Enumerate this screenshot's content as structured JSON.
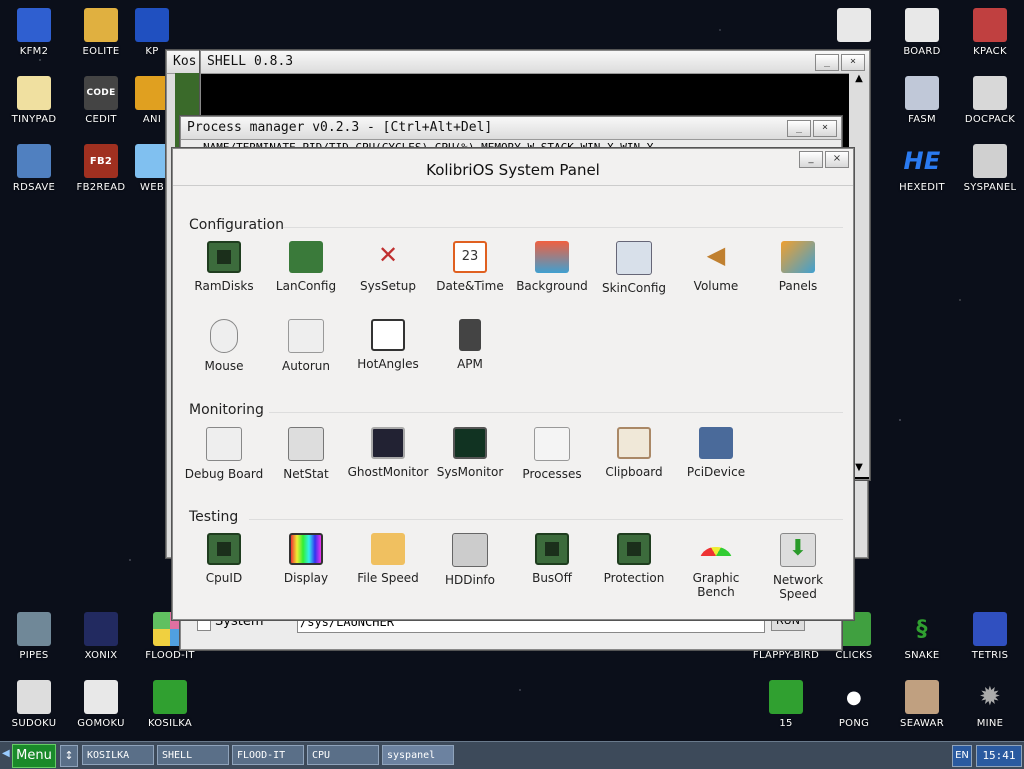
{
  "desktop": {
    "left_icons": [
      {
        "label": "KFM2",
        "icon": "floppy-icon",
        "color": "#2f5fd0"
      },
      {
        "label": "EOLITE",
        "icon": "folder-icon",
        "color": "#e0b040"
      },
      {
        "label": "KP",
        "icon": "kpack-icon",
        "color": "#2050c0"
      },
      {
        "label": "TINYPAD",
        "icon": "notepad-icon",
        "color": "#f0e0a0"
      },
      {
        "label": "CEDIT",
        "icon": "code-editor-icon",
        "color": "#444444"
      },
      {
        "label": "ANI",
        "icon": "animation-icon",
        "color": "#e0a020"
      },
      {
        "label": "RDSAVE",
        "icon": "save-icon",
        "color": "#5080c0"
      },
      {
        "label": "FB2READ",
        "icon": "book-icon",
        "color": "#a03020"
      },
      {
        "label": "WEB",
        "icon": "web-icon",
        "color": "#80c0f0"
      },
      {
        "label": "PIPES",
        "icon": "pipes-icon",
        "color": "#708898"
      },
      {
        "label": "XONIX",
        "icon": "xonix-icon",
        "color": "#222a60"
      },
      {
        "label": "FLOOD-IT",
        "icon": "flood-icon",
        "color": "#e070a0"
      },
      {
        "label": "SUDOKU",
        "icon": "sudoku-icon",
        "color": "#dddddd"
      },
      {
        "label": "GOMOKU",
        "icon": "gomoku-icon",
        "color": "#e8e8e8"
      },
      {
        "label": "KOSILKA",
        "icon": "lawnmower-icon",
        "color": "#30a030"
      }
    ],
    "right_icons": [
      {
        "label": "BOARD",
        "icon": "board-icon",
        "color": "#e8e8e8"
      },
      {
        "label": "KPACK",
        "icon": "hammer-icon",
        "color": "#c04040"
      },
      {
        "label": "FASM",
        "icon": "fasm-icon",
        "color": "#c0c8d8"
      },
      {
        "label": "DOCPACK",
        "icon": "cabinet-icon",
        "color": "#d8d8d8"
      },
      {
        "label": "HEXEDIT",
        "icon": "hex-icon",
        "color": "#2060e0"
      },
      {
        "label": "SYSPANEL",
        "icon": "sliders-icon",
        "color": "#d0d0d0"
      },
      {
        "label": "FLAPPY-BIRD",
        "icon": "bird-icon",
        "color": "#000000"
      },
      {
        "label": "CLICKS",
        "icon": "clicks-icon",
        "color": "#40a040"
      },
      {
        "label": "SNAKE",
        "icon": "snake-icon",
        "color": "#30a030"
      },
      {
        "label": "TETRIS",
        "icon": "tetris-icon",
        "color": "#3050c0"
      },
      {
        "label": "15",
        "icon": "fifteen-icon",
        "color": "#30a030"
      },
      {
        "label": "PONG",
        "icon": "pong-icon",
        "color": "#3060c0"
      },
      {
        "label": "SEAWAR",
        "icon": "ship-icon",
        "color": "#c0a080"
      },
      {
        "label": "MINE",
        "icon": "mine-icon",
        "color": "#888888"
      }
    ]
  },
  "windows": {
    "kos_title": "Kos",
    "shell_title": "SHELL 0.8.3",
    "procmgr_title": "Process manager v0.2.3 - [Ctrl+Alt+Del]",
    "procmgr_header": "NAME/TERMINATE   PID/TID  CPU(CYCLES) CPU(%)  MEMORY  W-STACK   WIN-X   WIN-Y",
    "launch_label": "System",
    "launch_path": "/sys/LAUNCHER",
    "launch_button": "RUN"
  },
  "panel": {
    "title": "KolibriOS System Panel",
    "sections": [
      {
        "name": "Configuration",
        "items": [
          "RamDisks",
          "LanConfig",
          "SysSetup",
          "Date&Time",
          "Background",
          "SkinConfig",
          "Volume",
          "Panels",
          "Mouse",
          "Autorun",
          "HotAngles",
          "APM"
        ]
      },
      {
        "name": "Monitoring",
        "items": [
          "Debug Board",
          "NetStat",
          "GhostMonitor",
          "SysMonitor",
          "Processes",
          "Clipboard",
          "PciDevice"
        ]
      },
      {
        "name": "Testing",
        "items": [
          "CpuID",
          "Display",
          "File Speed",
          "HDDinfo",
          "BusOff",
          "Protection",
          "Graphic Bench",
          "Network Speed"
        ]
      }
    ],
    "date_icon_text": "23"
  },
  "taskbar": {
    "menu": "Menu",
    "tasks": [
      "KOSILKA",
      "SHELL",
      "FLOOD-IT",
      "CPU",
      "syspanel"
    ],
    "lang": "EN",
    "clock": "15:41"
  }
}
